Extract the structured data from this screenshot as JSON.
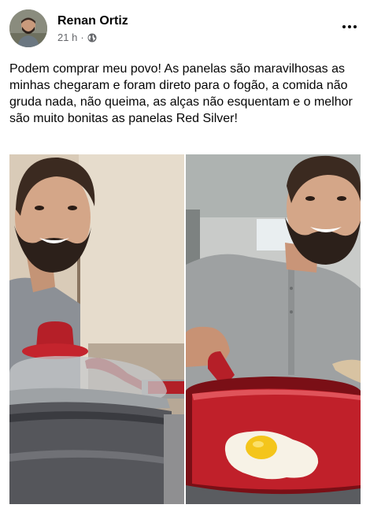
{
  "post": {
    "author": "Renan Ortiz",
    "time": "21 h",
    "privacy_icon": "globe-icon",
    "more_icon": "more-options-icon",
    "text": "Podem comprar meu povo! As panelas são maravilhosas as minhas chegaram e foram direto para o fogão, a comida não gruda nada, não queima, as alças não esquentam e o melhor são muito bonitas as panelas Red Silver!",
    "dot": "·"
  },
  "colors": {
    "text": "#050505",
    "secondary": "#65676b",
    "pan_red": "#c0202a"
  }
}
